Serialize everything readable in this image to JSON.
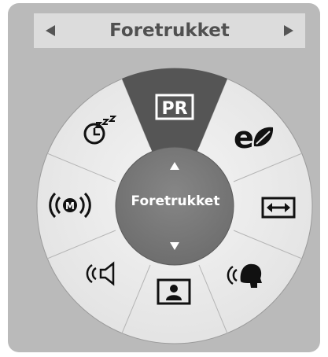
{
  "header": {
    "title": "Foretrukket",
    "left_arrow_icon": "triangle-left",
    "right_arrow_icon": "triangle-right"
  },
  "center": {
    "label": "Foretrukket",
    "up_icon": "triangle-up",
    "down_icon": "triangle-down"
  },
  "wheel_items": [
    {
      "name": "picture-mode",
      "icon": "picture-mode-icon",
      "label": "PR",
      "selected": true
    },
    {
      "name": "energy-saving",
      "icon": "eco-leaf-icon",
      "label": "e",
      "selected": false
    },
    {
      "name": "aspect-ratio",
      "icon": "aspect-ratio-icon",
      "selected": false
    },
    {
      "name": "audio-description",
      "icon": "voice-icon",
      "selected": false
    },
    {
      "name": "picture-in-picture",
      "icon": "person-frame-icon",
      "selected": false
    },
    {
      "name": "speaker",
      "icon": "speaker-icon",
      "selected": false
    },
    {
      "name": "multi-audio",
      "icon": "m-broadcast-icon",
      "label": "M",
      "selected": false
    },
    {
      "name": "sleep-timer",
      "icon": "sleep-timer-icon",
      "label": "z",
      "selected": false
    }
  ],
  "colors": {
    "panel": "#bababa",
    "header": "#dcdcdc",
    "wheel": "#e8e8e8",
    "selected": "#555555",
    "center": "#7a7a7a",
    "icon": "#111111"
  }
}
